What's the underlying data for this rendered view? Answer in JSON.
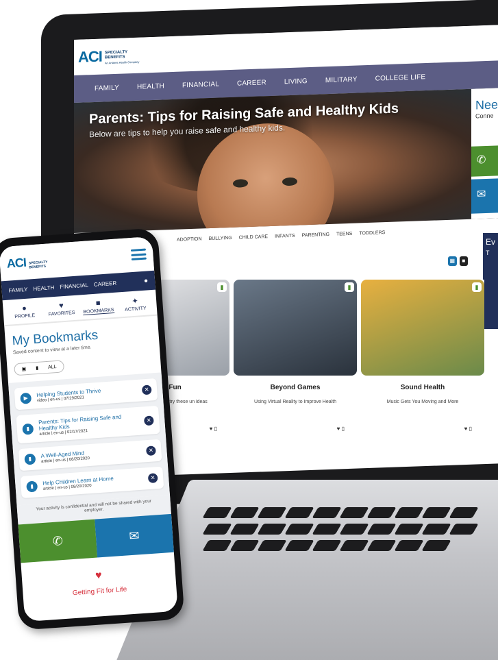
{
  "brand": {
    "logo_letters": "ACI",
    "logo_line1": "SPECIALTY",
    "logo_line2": "BENEFITS",
    "logo_line3": "An Antares Health Company"
  },
  "desktop": {
    "nav": [
      "FAMILY",
      "HEALTH",
      "FINANCIAL",
      "CAREER",
      "LIVING",
      "MILITARY",
      "COLLEGE LIFE"
    ],
    "hero": {
      "title": "Parents: Tips for Raising Safe and Healthy Kids",
      "subtitle": "Below are tips to help you raise safe and healthy kids."
    },
    "help": {
      "title": "Nee",
      "subtitle": "Conne"
    },
    "topics": [
      "ADOPTION",
      "BULLYING",
      "CHILD CARE",
      "INFANTS",
      "PARENTING",
      "TEENS",
      "TODDLERS"
    ],
    "events_tab": {
      "line1": "Ev",
      "line2": "T"
    },
    "cards": [
      {
        "title": "Day Fun",
        "desc": "s a damper on fun, try these un ideas",
        "color": "#c9cfd6"
      },
      {
        "title": "Beyond Games",
        "desc": "Using Virtual Reality to Improve Health",
        "color": "#4a5a6a"
      },
      {
        "title": "Sound Health",
        "desc": "Music Gets You Moving and More",
        "color": "#d9a030"
      }
    ]
  },
  "mobile": {
    "nav": [
      "FAMILY",
      "HEALTH",
      "FINANCIAL",
      "CAREER"
    ],
    "tabs": [
      {
        "label": "PROFILE",
        "icon": "profile-icon",
        "glyph": "●"
      },
      {
        "label": "FAVORITES",
        "icon": "heart-icon",
        "glyph": "♥"
      },
      {
        "label": "BOOKMARKS",
        "icon": "bookmark-icon",
        "glyph": "■"
      },
      {
        "label": "ACTIVITY",
        "icon": "activity-icon",
        "glyph": "✦"
      }
    ],
    "title": "My Bookmarks",
    "subtitle": "Saved content to view at a later time.",
    "filter_all": "ALL",
    "bookmarks": [
      {
        "title": "Helping Students to Thrive",
        "meta": "video | en-us | 07/29/2021",
        "icon": "video-icon"
      },
      {
        "title": "Parents: Tips for Raising Safe and Healthy Kids",
        "meta": "article | en-us | 02/17/2021",
        "icon": "article-icon"
      },
      {
        "title": "A Well-Aged Mind",
        "meta": "article | en-us | 08/20/2020",
        "icon": "article-icon"
      },
      {
        "title": "Help Children Learn at Home",
        "meta": "article | en-us | 08/20/2020",
        "icon": "article-icon"
      }
    ],
    "note": "Your activity is confidential and will not be shared with your employer.",
    "footer": "Getting Fit for Life"
  },
  "colors": {
    "navy": "#21305a",
    "blue": "#1b74ad",
    "green": "#4c8f2e",
    "purple": "#5c5d85",
    "red": "#d6313d"
  }
}
